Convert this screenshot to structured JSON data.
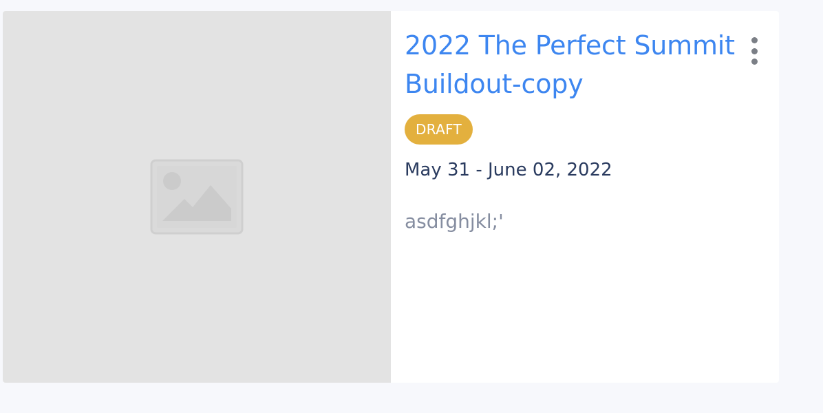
{
  "event_card": {
    "thumbnail": {
      "icon": "image-placeholder-icon",
      "background_color": "#e3e3e3"
    },
    "title": "2022 The Perfect Summit Buildout-copy",
    "title_color": "#3d86f0",
    "status_badge": {
      "label": "DRAFT",
      "color": "#e3b03e"
    },
    "date_range": "May 31 - June 02, 2022",
    "description": "asdfghjkl;'",
    "menu_icon": "more-vertical-icon"
  }
}
